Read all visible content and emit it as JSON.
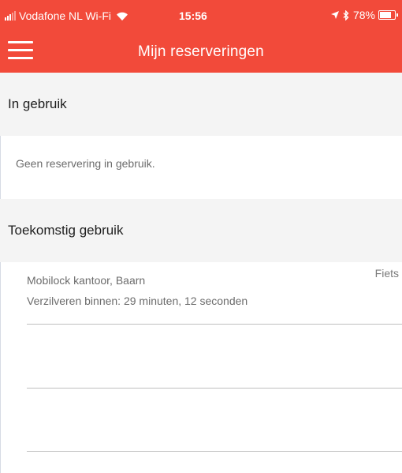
{
  "status_bar": {
    "carrier": "Vodafone NL Wi-Fi",
    "time": "15:56",
    "battery_percent": "78%",
    "battery_level": 0.78,
    "icons": [
      "signal-icon",
      "wifi-icon",
      "location-arrow-icon",
      "bluetooth-icon",
      "battery-icon"
    ]
  },
  "header": {
    "title": "Mijn reserveringen",
    "menu_icon": "hamburger-menu-icon"
  },
  "sections": {
    "in_use": {
      "title": "In gebruik",
      "empty_message": "Geen reservering in gebruik."
    },
    "future_use": {
      "title": "Toekomstig gebruik",
      "reservations": [
        {
          "location": "Mobilock kantoor, Baarn",
          "type": "Fiets",
          "redeem_within": "Verzilveren binnen: 29 minuten, 12 seconden"
        }
      ]
    }
  },
  "colors": {
    "brand": "#f24a3a",
    "section_background": "#f4f4f4",
    "divider": "#bfbfbf",
    "secondary_text": "#6c6c6c"
  }
}
